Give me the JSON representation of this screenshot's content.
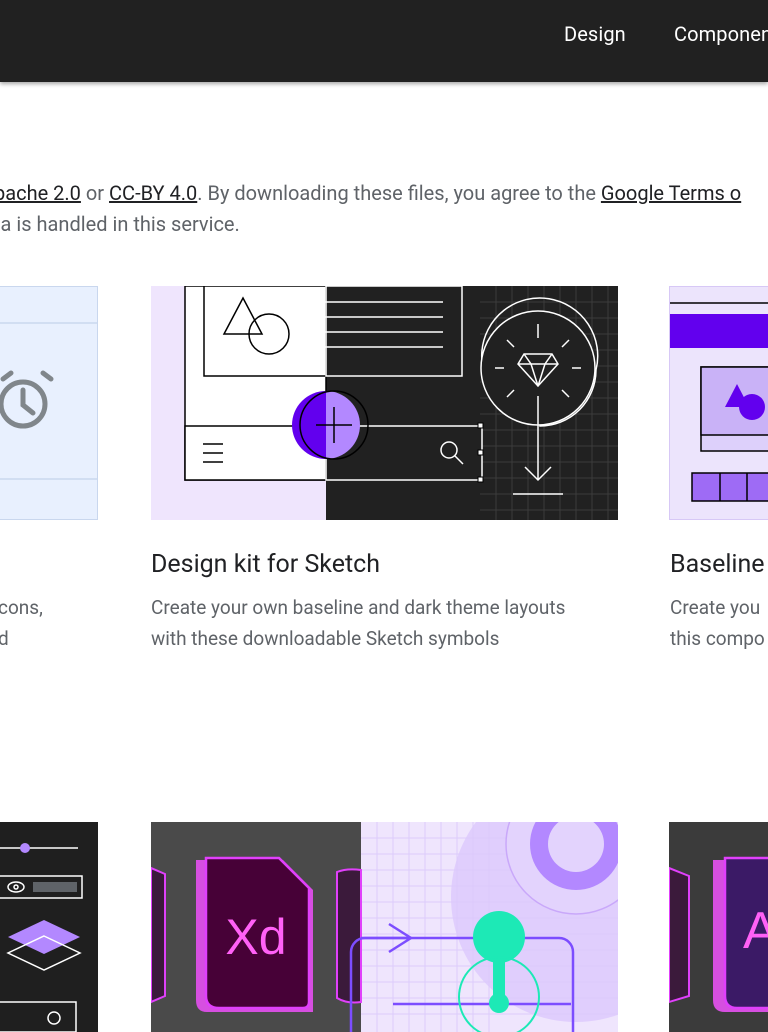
{
  "nav": {
    "design": "Design",
    "components": "Components"
  },
  "license": {
    "line1_prefix": "pache 2.0",
    "or": " or ",
    "ccby": "CC-BY 4.0",
    "line1_middle": ". By downloading these files, you agree to the ",
    "terms": "Google Terms o",
    "line2": "ta is handled in this service."
  },
  "cards": [
    {
      "title": "",
      "desc_line1": "cons,",
      "desc_line2": "d"
    },
    {
      "title": "Design kit for Sketch",
      "desc_line1": "Create your own baseline and dark theme layouts",
      "desc_line2": "with these downloadable Sketch symbols"
    },
    {
      "title": "Baseline",
      "desc_line1": "Create you",
      "desc_line2": "this compo"
    }
  ],
  "thumbnails": {
    "xd_label": "Xd",
    "ai_label": "A"
  },
  "colors": {
    "topbar": "#212121",
    "accent_purple": "#6200ee",
    "light_purple": "#b388ff",
    "teal": "#1de9b6",
    "magenta": "#e040fb"
  }
}
